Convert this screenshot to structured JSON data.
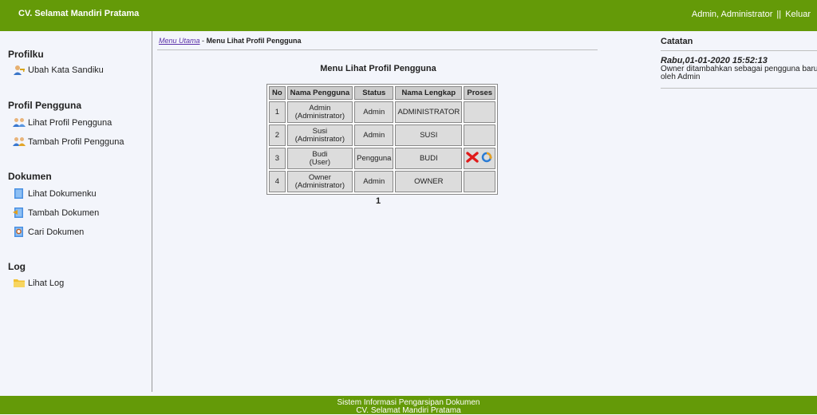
{
  "header": {
    "brand": "CV. Selamat Mandiri Pratama",
    "user": "Admin, Administrator",
    "separator": "||",
    "logout": "Keluar"
  },
  "sidebar": {
    "sections": [
      {
        "title": "Profilku",
        "items": [
          {
            "label": "Ubah Kata Sandiku",
            "icon": "user-key-icon"
          }
        ]
      },
      {
        "title": "Profil Pengguna",
        "items": [
          {
            "label": "Lihat Profil Pengguna",
            "icon": "users-icon"
          },
          {
            "label": "Tambah Profil Pengguna",
            "icon": "users-add-icon"
          }
        ]
      },
      {
        "title": "Dokumen",
        "items": [
          {
            "label": "Lihat Dokumenku",
            "icon": "document-icon"
          },
          {
            "label": "Tambah Dokumen",
            "icon": "document-add-icon"
          },
          {
            "label": "Cari Dokumen",
            "icon": "document-search-icon"
          }
        ]
      },
      {
        "title": "Log",
        "items": [
          {
            "label": "Lihat Log",
            "icon": "folder-icon"
          }
        ]
      }
    ]
  },
  "breadcrumb": {
    "home": "Menu Utama",
    "separator": "-",
    "current": "Menu Lihat Profil Pengguna"
  },
  "main": {
    "title": "Menu Lihat Profil Pengguna",
    "table": {
      "headers": [
        "No",
        "Nama Pengguna",
        "Status",
        "Nama Lengkap",
        "Proses"
      ],
      "rows": [
        {
          "no": "1",
          "name": "Admin",
          "role": "(Administrator)",
          "status": "Admin",
          "full": "ADMINISTRATOR",
          "actions": false
        },
        {
          "no": "2",
          "name": "Susi",
          "role": "(Administrator)",
          "status": "Admin",
          "full": "SUSI",
          "actions": false
        },
        {
          "no": "3",
          "name": "Budi",
          "role": "(User)",
          "status": "Pengguna",
          "full": "BUDI",
          "actions": true
        },
        {
          "no": "4",
          "name": "Owner",
          "role": "(Administrator)",
          "status": "Admin",
          "full": "OWNER",
          "actions": false
        }
      ]
    },
    "page": "1"
  },
  "notes": {
    "title": "Catatan",
    "date": "Rabu,01-01-2020 15:52:13",
    "text": "Owner ditambahkan sebagai pengguna baru oleh Admin"
  },
  "footer": {
    "line1": "Sistem Informasi Pengarsipan Dokumen",
    "line2": "CV. Selamat Mandiri Pratama"
  },
  "colors": {
    "header_bg": "#649a08",
    "page_bg": "#f3f5fb",
    "table_cell": "#dcdcdc",
    "link": "#5a2fa8"
  }
}
